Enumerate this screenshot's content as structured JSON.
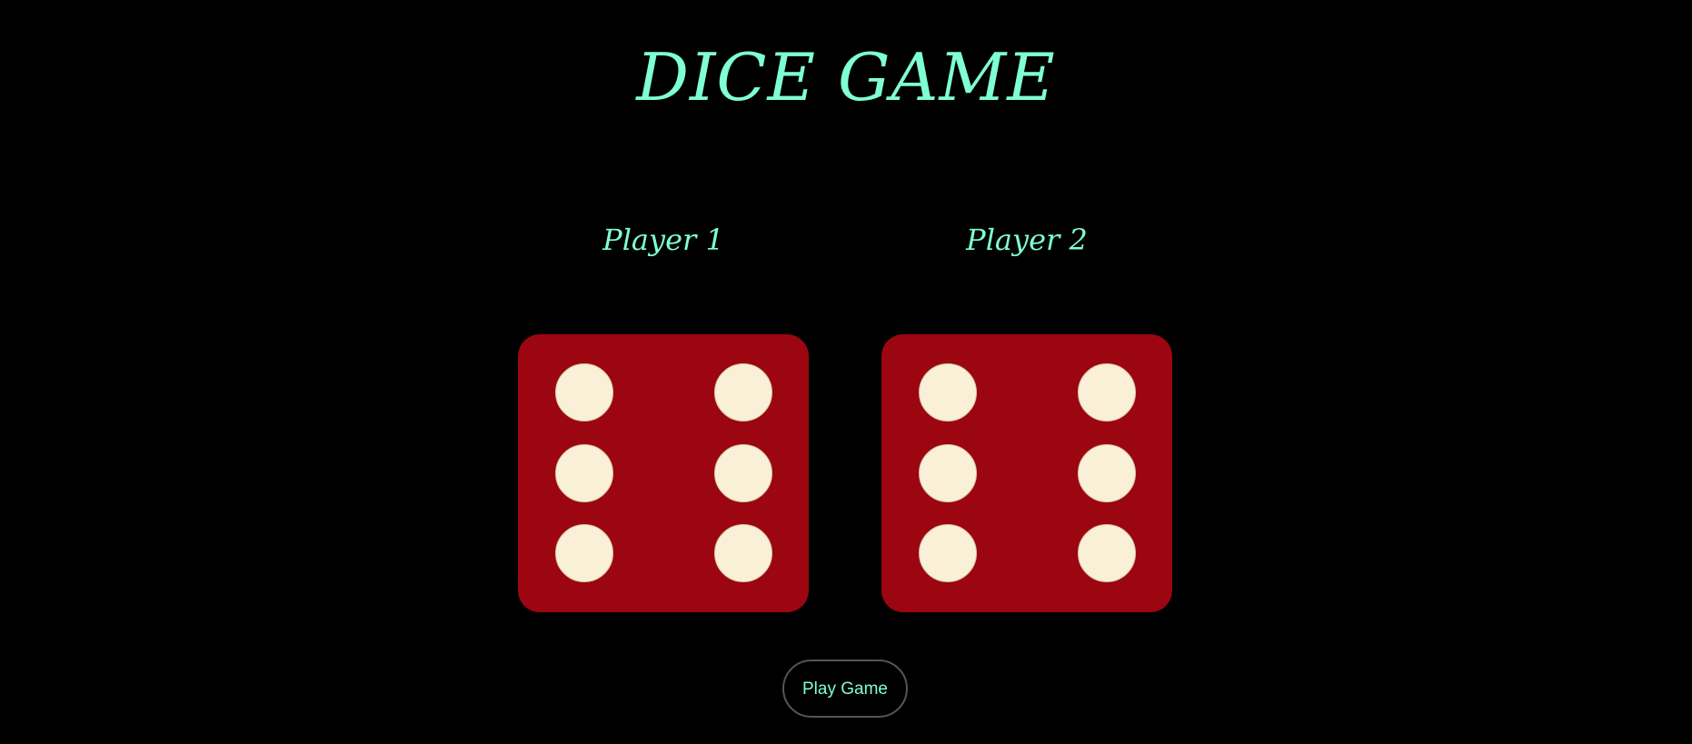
{
  "title": "DICE GAME",
  "players": [
    {
      "label": "Player 1",
      "die_value": 6
    },
    {
      "label": "Player 2",
      "die_value": 6
    }
  ],
  "play_button": {
    "label": "Play Game"
  },
  "colors": {
    "background": "#000000",
    "accent": "#7fffd4",
    "die_face": "#9b0610",
    "pip": "#faf0d8"
  }
}
